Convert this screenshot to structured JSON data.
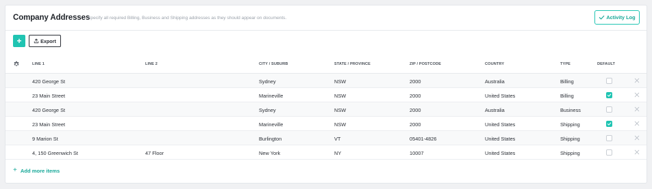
{
  "header": {
    "title": "Company Addresses",
    "subtitle": "Specify all required Billing, Business and Shipping addresses as they should appear on documents.",
    "activity_log_label": "Activity Log"
  },
  "toolbar": {
    "add_symbol": "+",
    "export_label": "Export"
  },
  "table": {
    "columns": [
      "LINE 1",
      "LINE 2",
      "CITY / SUBURB",
      "STATE / PROVINCE",
      "ZIP / POSTCODE",
      "COUNTRY",
      "TYPE",
      "DEFAULT"
    ],
    "rows": [
      {
        "line1": "420 George St",
        "line2": "",
        "city": "Sydney",
        "state": "NSW",
        "zip": "2000",
        "country": "Australia",
        "type": "Billing",
        "default": false
      },
      {
        "line1": "23 Main Street",
        "line2": "",
        "city": "Marineville",
        "state": "NSW",
        "zip": "2000",
        "country": "United States",
        "type": "Billing",
        "default": true
      },
      {
        "line1": "420 George St",
        "line2": "",
        "city": "Sydney",
        "state": "NSW",
        "zip": "2000",
        "country": "Australia",
        "type": "Business",
        "default": false
      },
      {
        "line1": "23 Main Street",
        "line2": "",
        "city": "Marineville",
        "state": "NSW",
        "zip": "2000",
        "country": "United States",
        "type": "Shipping",
        "default": true
      },
      {
        "line1": "9 Marion St",
        "line2": "",
        "city": "Burlington",
        "state": "VT",
        "zip": "05401-4826",
        "country": "United States",
        "type": "Shipping",
        "default": false
      },
      {
        "line1": "4, 150 Greenwich St",
        "line2": "47 Floor",
        "city": "New York",
        "state": "NY",
        "zip": "10007",
        "country": "United States",
        "type": "Shipping",
        "default": false
      }
    ]
  },
  "footer": {
    "add_more_label": "Add more items"
  },
  "colors": {
    "accent": "#20c4b2",
    "accent_text": "#17a898",
    "row_alt": "#f8f9fa"
  },
  "icons": [
    "gear-icon",
    "check-icon",
    "upload-icon",
    "plus-icon",
    "close-icon"
  ]
}
